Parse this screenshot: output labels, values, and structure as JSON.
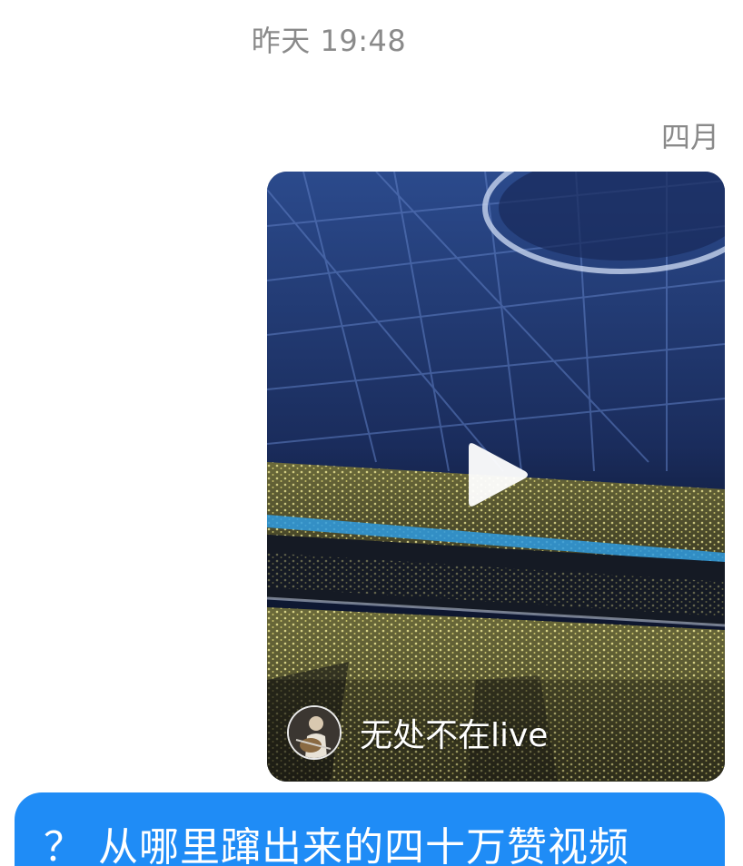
{
  "chat": {
    "timestamp": "昨天 19:48",
    "sender_name": "四月"
  },
  "video_card": {
    "author_name": "无处不在live",
    "play_icon": "play-icon",
    "avatar_icon": "avatar-guitarist"
  },
  "message": {
    "text": "？ 从哪里蹿出来的四十万赞视频"
  },
  "colors": {
    "bubble_blue": "#1f8cf6",
    "meta_gray": "#8a8a8a",
    "card_bg": "#1b2a55"
  }
}
